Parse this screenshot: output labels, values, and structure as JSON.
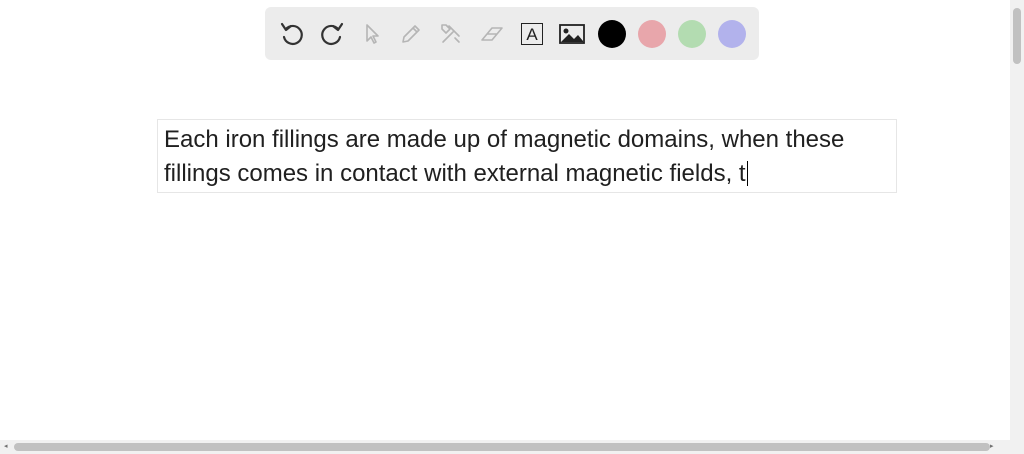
{
  "toolbar": {
    "tools": [
      {
        "name": "undo",
        "icon": "undo-icon",
        "enabled": true
      },
      {
        "name": "redo",
        "icon": "redo-icon",
        "enabled": true
      },
      {
        "name": "select",
        "icon": "pointer-icon",
        "enabled": false
      },
      {
        "name": "pen",
        "icon": "pencil-icon",
        "enabled": false
      },
      {
        "name": "tools",
        "icon": "tools-icon",
        "enabled": false
      },
      {
        "name": "eraser",
        "icon": "eraser-icon",
        "enabled": false
      },
      {
        "name": "text",
        "icon": "text-box-icon",
        "enabled": true,
        "glyph": "A"
      },
      {
        "name": "image",
        "icon": "image-icon",
        "enabled": true
      }
    ],
    "colors": [
      {
        "name": "black",
        "hex": "#000000",
        "selected": true
      },
      {
        "name": "red",
        "hex": "#e8a6ab"
      },
      {
        "name": "green",
        "hex": "#b3dcb1"
      },
      {
        "name": "blue",
        "hex": "#b2b2ec"
      }
    ]
  },
  "canvas": {
    "text_lines": [
      "Each iron fillings are made up of magnetic domains, when these",
      "fillings comes in contact with external magnetic fields, t"
    ]
  },
  "scrollbars": {
    "left_arrow": "◂",
    "right_arrow": "▸"
  }
}
